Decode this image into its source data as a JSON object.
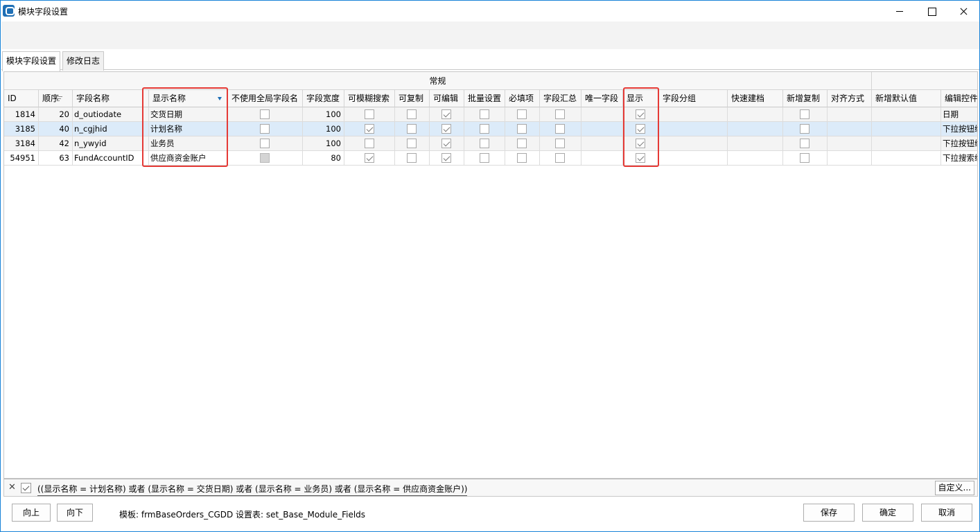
{
  "window": {
    "title": "模块字段设置"
  },
  "tabs": [
    {
      "label": "模块字段设置",
      "active": true
    },
    {
      "label": "修改日志",
      "active": false
    }
  ],
  "grid": {
    "band_label": "常规",
    "columns": [
      "ID",
      "顺序",
      "字段名称",
      "显示名称",
      "不使用全局字段名",
      "字段宽度",
      "可模糊搜索",
      "可复制",
      "可编辑",
      "批量设置",
      "必填项",
      "字段汇总",
      "唯一字段",
      "显示",
      "字段分组",
      "快速建档",
      "新增复制",
      "对齐方式",
      "新增默认值",
      "编辑控件"
    ],
    "rows": [
      {
        "id": "1814",
        "order": "20",
        "field_name": "d_outiodate",
        "display_name": "交货日期",
        "no_global": false,
        "width": "100",
        "fuzzy": false,
        "copy": false,
        "editable": true,
        "batch": false,
        "required": false,
        "summary": false,
        "unique": "",
        "show": true,
        "group": "",
        "quick": "",
        "add_copy": false,
        "align": "",
        "default": "",
        "control": "日期"
      },
      {
        "id": "3185",
        "order": "40",
        "field_name": "n_cgjhid",
        "display_name": "计划名称",
        "no_global": false,
        "width": "100",
        "fuzzy": true,
        "copy": false,
        "editable": true,
        "batch": false,
        "required": false,
        "summary": false,
        "unique": "",
        "show": true,
        "group": "",
        "quick": "",
        "add_copy": false,
        "align": "",
        "default": "",
        "control": "下拉按钮编辑"
      },
      {
        "id": "3184",
        "order": "42",
        "field_name": "n_ywyid",
        "display_name": "业务员",
        "no_global": false,
        "width": "100",
        "fuzzy": false,
        "copy": false,
        "editable": true,
        "batch": false,
        "required": false,
        "summary": false,
        "unique": "",
        "show": true,
        "group": "",
        "quick": "",
        "add_copy": false,
        "align": "",
        "default": "",
        "control": "下拉按钮编辑"
      },
      {
        "id": "54951",
        "order": "63",
        "field_name": "FundAccountID",
        "display_name": "供应商资金账户",
        "no_global": "disabled",
        "width": "80",
        "fuzzy": true,
        "copy": false,
        "editable": true,
        "batch": false,
        "required": false,
        "summary": false,
        "unique": "",
        "show": true,
        "group": "",
        "quick": "",
        "add_copy": false,
        "align": "",
        "default": "",
        "control": "下拉搜索编辑"
      }
    ]
  },
  "filter": {
    "text": "((显示名称 = 计划名称) 或者 (显示名称 = 交货日期) 或者 (显示名称 = 业务员) 或者 (显示名称 = 供应商资金账户))",
    "custom_label": "自定义..."
  },
  "bottom": {
    "up_label": "向上",
    "down_label": "向下",
    "status_text": "模板: frmBaseOrders_CGDD  设置表: set_Base_Module_Fields",
    "save_label": "保存",
    "ok_label": "确定",
    "cancel_label": "取消"
  },
  "colors": {
    "highlight": "#e53935",
    "selected_row": "#dcebf9",
    "accent": "#1f6fb5"
  }
}
